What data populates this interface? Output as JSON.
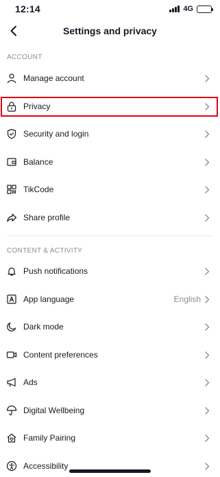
{
  "status_bar": {
    "time": "12:14",
    "network": "4G",
    "battery_level": 0.9
  },
  "nav": {
    "title": "Settings and privacy"
  },
  "sections": [
    {
      "header": "ACCOUNT"
    },
    {
      "header": "CONTENT & ACTIVITY"
    }
  ],
  "account_items": [
    {
      "label": "Manage account",
      "icon": "person-icon"
    },
    {
      "label": "Privacy",
      "icon": "lock-icon",
      "highlighted": true
    },
    {
      "label": "Security and login",
      "icon": "shield-icon"
    },
    {
      "label": "Balance",
      "icon": "wallet-icon"
    },
    {
      "label": "TikCode",
      "icon": "qr-code-icon"
    },
    {
      "label": "Share profile",
      "icon": "share-icon"
    }
  ],
  "content_items": [
    {
      "label": "Push notifications",
      "icon": "bell-icon"
    },
    {
      "label": "App language",
      "icon": "language-icon",
      "value": "English"
    },
    {
      "label": "Dark mode",
      "icon": "moon-icon"
    },
    {
      "label": "Content preferences",
      "icon": "video-icon"
    },
    {
      "label": "Ads",
      "icon": "megaphone-icon"
    },
    {
      "label": "Digital Wellbeing",
      "icon": "umbrella-icon"
    },
    {
      "label": "Family Pairing",
      "icon": "home-heart-icon"
    },
    {
      "label": "Accessibility",
      "icon": "accessibility-icon"
    }
  ],
  "colors": {
    "highlight": "#e10012",
    "text": "#161823",
    "muted": "#8a8b91"
  }
}
